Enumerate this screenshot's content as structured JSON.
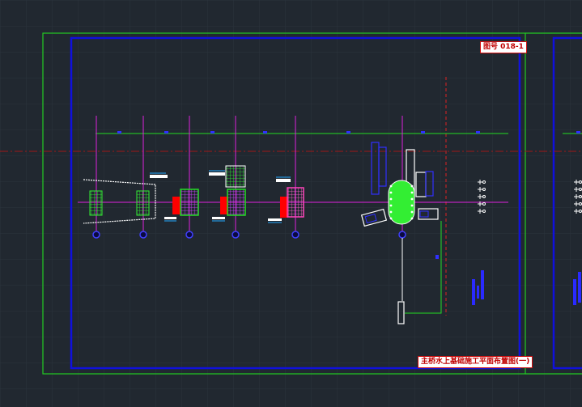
{
  "drawing": {
    "number_label": "图号 018-1",
    "title_label": "主桥水上基础施工平面布置图(一)"
  },
  "colors": {
    "background": "#212830",
    "grid": "#2f3843",
    "sheet_border": "#22cc22",
    "frame": "#1010dd",
    "centerline": "#b01818",
    "axis": "#dd22dd",
    "trestle": "#22dd22",
    "cofferdam": "#ee1188",
    "barge": "#ff0000",
    "equipment": "#ffffff",
    "marker": "#3030ff"
  },
  "icons": [
    "pier-axis-marker",
    "crane-barge-icon",
    "cofferdam-icon",
    "platform-icon"
  ]
}
